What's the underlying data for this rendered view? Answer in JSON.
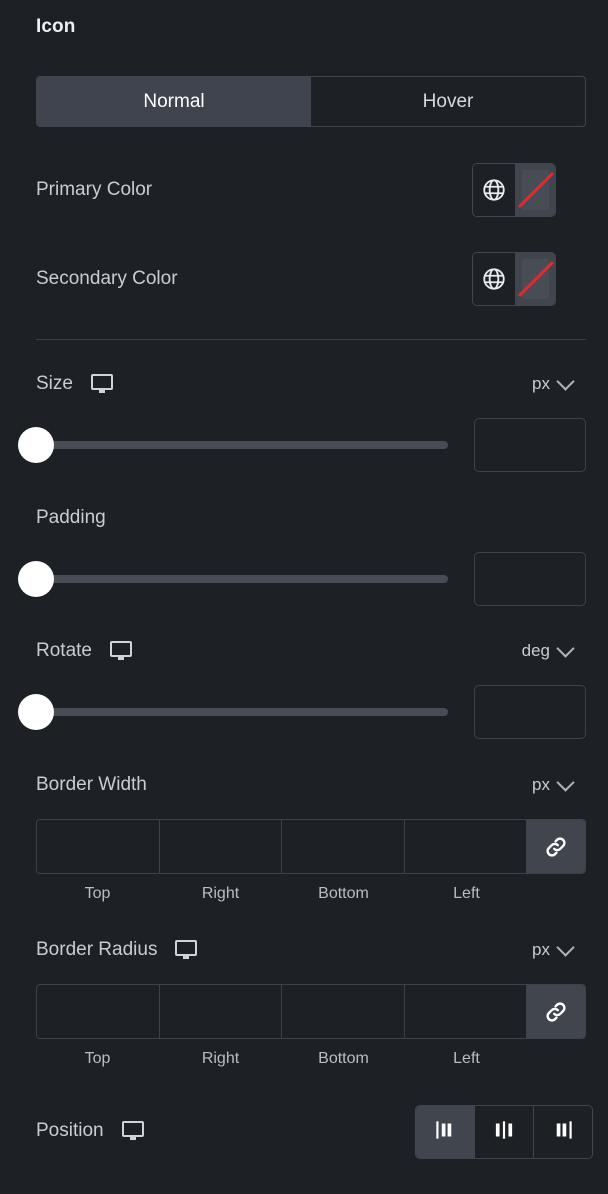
{
  "section": {
    "title": "Icon"
  },
  "state_tabs": {
    "active": "Normal",
    "items": [
      {
        "label": "Normal",
        "active": true
      },
      {
        "label": "Hover",
        "active": false
      }
    ]
  },
  "colors": {
    "accent_red": "#e02b2b",
    "panel_bg": "#1d2125",
    "active_bg": "#3f444e",
    "border": "#3d424a",
    "text": "#c9cdd3"
  },
  "controls": {
    "primary_color": {
      "label": "Primary Color",
      "global_icon": "globe-icon",
      "swatch_icon": "no-color-slash-icon",
      "value": ""
    },
    "secondary_color": {
      "label": "Secondary Color",
      "global_icon": "globe-icon",
      "swatch_icon": "no-color-slash-icon",
      "value": ""
    },
    "size": {
      "label": "Size",
      "device_icon": "desktop-monitor-icon",
      "unit": "px",
      "unit_caret": "chevron-down-icon",
      "value": "",
      "slider_percent": 0
    },
    "padding": {
      "label": "Padding",
      "value": "",
      "slider_percent": 0
    },
    "rotate": {
      "label": "Rotate",
      "device_icon": "desktop-monitor-icon",
      "unit": "deg",
      "unit_caret": "chevron-down-icon",
      "value": "",
      "slider_percent": 0
    },
    "border_width": {
      "label": "Border Width",
      "unit": "px",
      "unit_caret": "chevron-down-icon",
      "link_icon": "link-chain-icon",
      "fields": [
        {
          "label": "Top",
          "value": ""
        },
        {
          "label": "Right",
          "value": ""
        },
        {
          "label": "Bottom",
          "value": ""
        },
        {
          "label": "Left",
          "value": ""
        }
      ]
    },
    "border_radius": {
      "label": "Border Radius",
      "device_icon": "desktop-monitor-icon",
      "unit": "px",
      "unit_caret": "chevron-down-icon",
      "link_icon": "link-chain-icon",
      "fields": [
        {
          "label": "Top",
          "value": ""
        },
        {
          "label": "Right",
          "value": ""
        },
        {
          "label": "Bottom",
          "value": ""
        },
        {
          "label": "Left",
          "value": ""
        }
      ]
    },
    "position": {
      "label": "Position",
      "device_icon": "desktop-monitor-icon",
      "options": [
        {
          "icon": "align-start-icon",
          "active": true
        },
        {
          "icon": "align-center-icon",
          "active": false
        },
        {
          "icon": "align-end-icon",
          "active": false
        }
      ]
    }
  }
}
